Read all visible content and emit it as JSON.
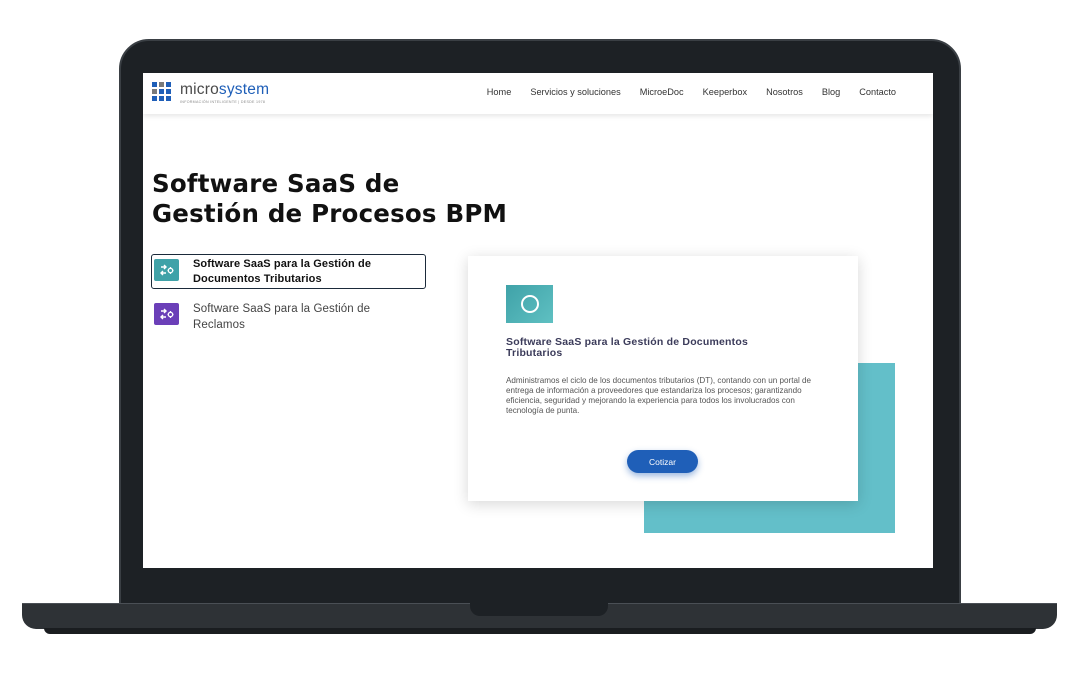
{
  "brand": {
    "name_part1": "micro",
    "name_part2": "system",
    "tagline": "INFORMACIÓN INTELIGENTE | DESDE 1978"
  },
  "nav": {
    "items": [
      "Home",
      "Servicios y soluciones",
      "MicroeDoc",
      "Keeperbox",
      "Nosotros",
      "Blog",
      "Contacto"
    ]
  },
  "hero": {
    "title_line1": "Software SaaS de",
    "title_line2": "Gestión de Procesos BPM"
  },
  "tabs": [
    {
      "label": "Software SaaS para la Gestión de Documentos Tributarios",
      "active": true,
      "icon": "gear-swap-icon",
      "icon_color": "#3fa2a8"
    },
    {
      "label": "Software SaaS para la Gestión de Reclamos",
      "active": false,
      "icon": "gear-swap-icon",
      "icon_color": "#6b3fb8"
    }
  ],
  "card": {
    "icon": "circle-icon",
    "title": "Software SaaS para la Gestión de Documentos Tributarios",
    "description": "Administramos el ciclo de los documentos tributarios (DT), contando con un portal de entrega de información a proveedores que estandariza los procesos; garantizando eficiencia, seguridad y mejorando la experiencia para todos los involucrados con tecnología de punta.",
    "cta_label": "Cotizar"
  },
  "colors": {
    "accent": "#1f5fb8",
    "teal": "#63bfc9",
    "laptop_frame": "#1d2125"
  }
}
